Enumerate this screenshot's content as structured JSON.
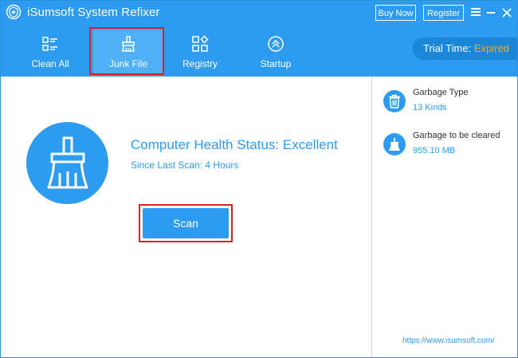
{
  "window": {
    "title": "iSumsoft System Refixer",
    "buy_label": "Buy Now",
    "register_label": "Register"
  },
  "nav": {
    "items": [
      {
        "label": "Clean All",
        "icon": "list-icon"
      },
      {
        "label": "Junk File",
        "icon": "brush-icon",
        "selected": true
      },
      {
        "label": "Registry",
        "icon": "grid-icon"
      },
      {
        "label": "Startup",
        "icon": "chevron-up-circle-icon"
      }
    ]
  },
  "trial": {
    "label": "Trial Time:",
    "status": "Expired"
  },
  "status": {
    "title": "Computer Health Status: Excellent",
    "since": "Since Last Scan: 4 Hours",
    "scan_label": "Scan"
  },
  "side": {
    "garbage_type_label": "Garbage Type",
    "garbage_type_value": "13 Kinds",
    "to_clear_label": "Garbage to be cleared",
    "to_clear_value": "955.10 MB",
    "website": "https://www.isumsoft.com/"
  },
  "colors": {
    "primary": "#2d9cf0",
    "selected_tab": "#4fb0f6",
    "trial_bg": "#1b87d6",
    "expired": "#f6a623",
    "highlight": "#e02020"
  }
}
